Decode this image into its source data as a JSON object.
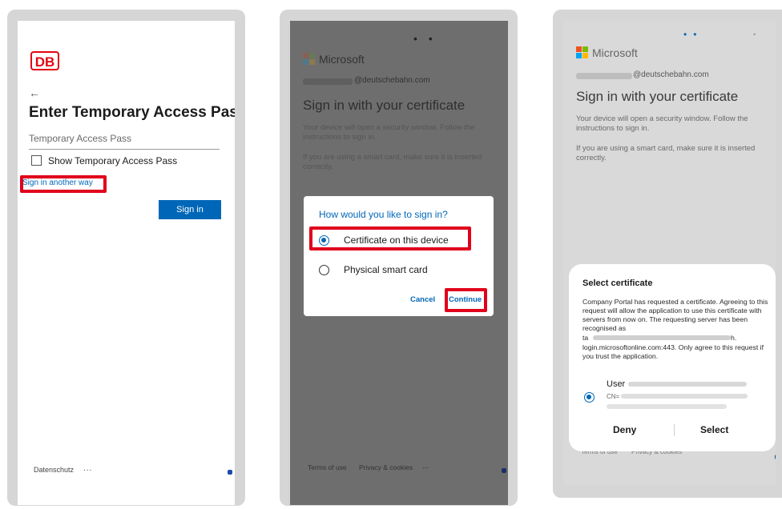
{
  "screen1": {
    "logo_text": "DB",
    "back_arrow": "←",
    "title": "Enter Temporary Access Pass",
    "input_placeholder": "Temporary Access Pass",
    "checkbox_label": "Show Temporary Access Pass",
    "alt_link": "Sign in another way",
    "signin_button": "Sign in",
    "footer_link": "Datenschutz",
    "footer_more": "..."
  },
  "screen2": {
    "brand": "Microsoft",
    "email_suffix": "@deutschebahn.com",
    "title": "Sign in with your certificate",
    "body1": "Your device will open a security window. Follow the instructions to sign in.",
    "body2": "If you are using a smart card, make sure it is inserted correctly.",
    "dialog": {
      "question": "How would you like to sign in?",
      "option1": "Certificate on this device",
      "option2": "Physical smart card",
      "cancel": "Cancel",
      "continue": "Continue"
    },
    "footer_terms": "Terms of use",
    "footer_privacy": "Privacy & cookies",
    "footer_more": "..."
  },
  "screen3": {
    "brand": "Microsoft",
    "email_suffix": "@deutschebahn.com",
    "title": "Sign in with your certificate",
    "body1": "Your device will open a security window. Follow the instructions to sign in.",
    "body2": "If you are using a smart card, make sure it is inserted correctly.",
    "sheet": {
      "heading": "Select certificate",
      "text_a": "Company Portal has requested a certificate. Agreeing to this request will allow the application to use this certificate with servers from now on. The requesting server has been recognised as",
      "text_b_prefix": "ta",
      "text_b_suffix": "h.",
      "text_c": "login.microsoftonline.com:443. Only agree to this request if you trust the application.",
      "cert_user": "User",
      "cert_cn": "CN=",
      "deny": "Deny",
      "select": "Select"
    },
    "footer_terms": "Terms of use",
    "footer_privacy": "Privacy & cookies",
    "footer_more": "..."
  },
  "colors": {
    "db_red": "#e30613",
    "highlight_red": "#e1001b",
    "ms_blue": "#0067b8",
    "ms_logo": [
      "#f25022",
      "#7fba00",
      "#00a4ef",
      "#ffb900"
    ]
  }
}
